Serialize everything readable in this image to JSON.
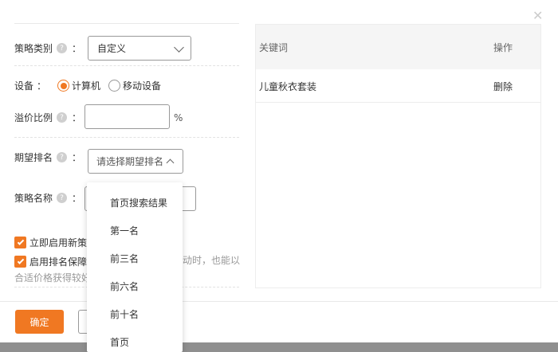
{
  "dialog": {
    "close_icon": "close-icon"
  },
  "form": {
    "strategy_type": {
      "label": "策略类别",
      "colon": "：",
      "value": "自定义"
    },
    "device": {
      "label": "设备",
      "colon": "：",
      "options": [
        "计算机",
        "移动设备"
      ],
      "selected": "计算机"
    },
    "premium": {
      "label": "溢价比例",
      "colon": "：",
      "unit": "%"
    },
    "rank": {
      "label": "期望排名",
      "colon": "：",
      "placeholder": "请选择期望排名"
    },
    "strategy_name": {
      "label": "策略名称",
      "colon": "："
    },
    "check1": {
      "label": "立即启用新策",
      "checked": true
    },
    "check2": {
      "label": "启用排名保障",
      "tail": "动时，也能以",
      "line2": "合适价格获得较好"
    }
  },
  "keyword_panel": {
    "headers": {
      "keyword": "关键词",
      "action": "操作"
    },
    "rows": [
      {
        "keyword": "儿童秋衣套装",
        "action": "删除"
      }
    ]
  },
  "rank_dropdown": {
    "options": [
      "首页搜索结果",
      "第一名",
      "前三名",
      "前六名",
      "前十名",
      "首页"
    ]
  },
  "footer": {
    "ok_label": "确定"
  },
  "colors": {
    "accent": "#f07822"
  }
}
